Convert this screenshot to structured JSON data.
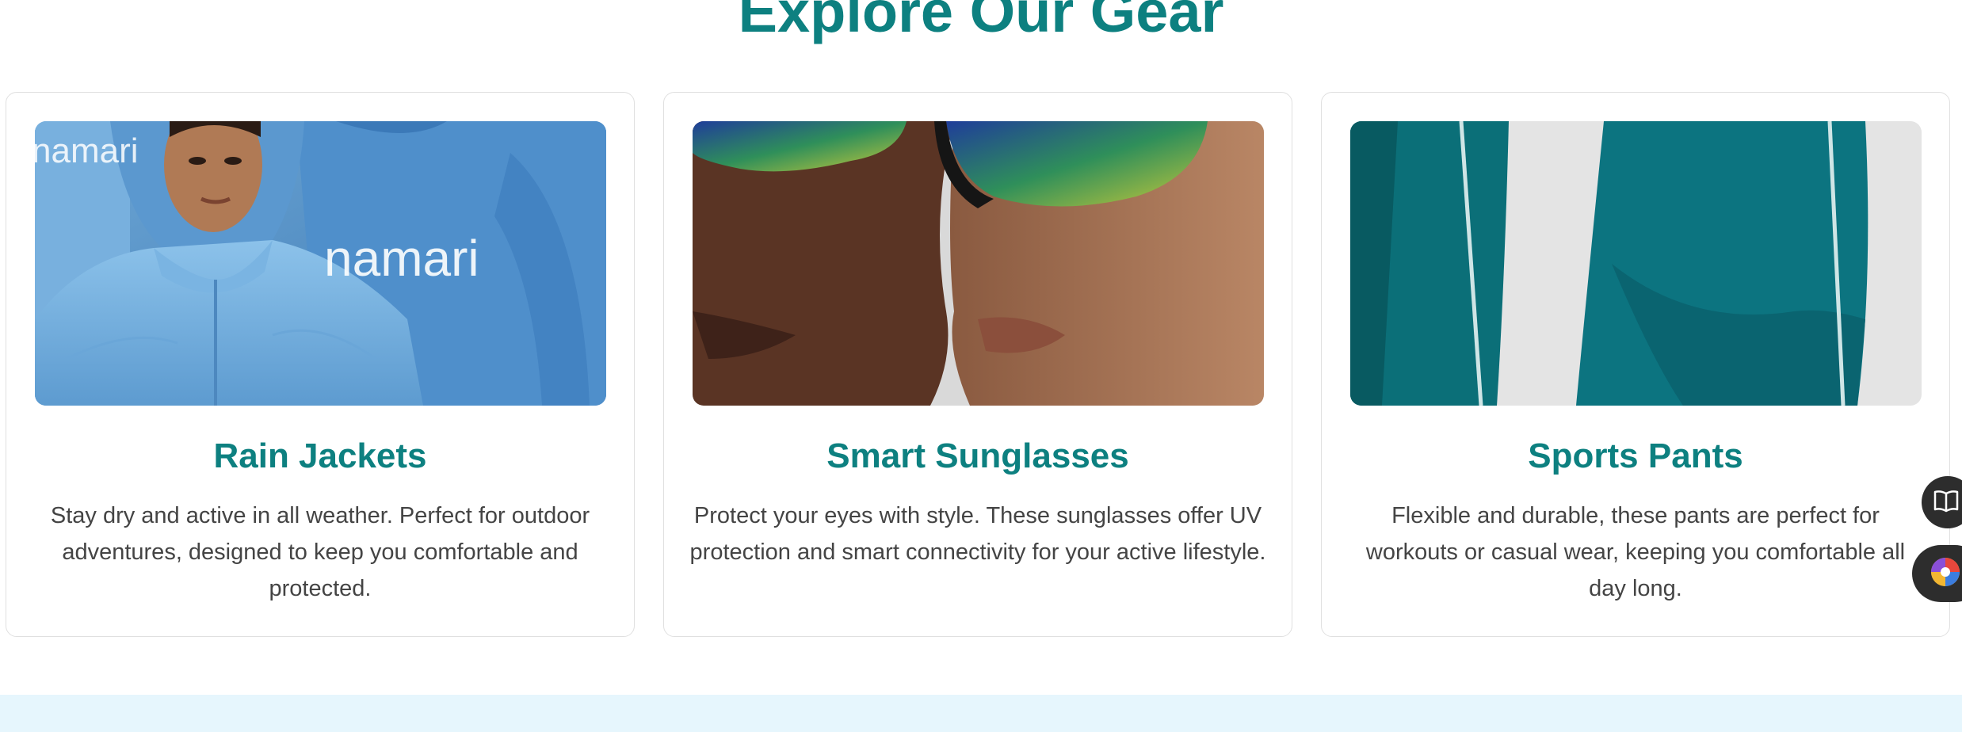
{
  "section": {
    "title": "Explore Our Gear"
  },
  "cards": [
    {
      "title": "Rain Jackets",
      "description": "Stay dry and active in all weather. Perfect for outdoor adventures, designed to keep you comfortable and protected.",
      "image_brand_text": "namari"
    },
    {
      "title": "Smart Sunglasses",
      "description": "Protect your eyes with style. These sunglasses offer UV protection and smart connectivity for your active lifestyle."
    },
    {
      "title": "Sports Pants",
      "description": "Flexible and durable, these pants are perfect for workouts or casual wear, keeping you comfortable all day long."
    }
  ],
  "floating_buttons": {
    "reader_icon": "book-icon",
    "app_icon": "color-wheel-icon"
  },
  "colors": {
    "accent": "#0d8080",
    "body_text": "#444444",
    "card_border": "#e0e0e0",
    "band": "#e6f6fd",
    "floating_button": "#2d2d2d"
  }
}
